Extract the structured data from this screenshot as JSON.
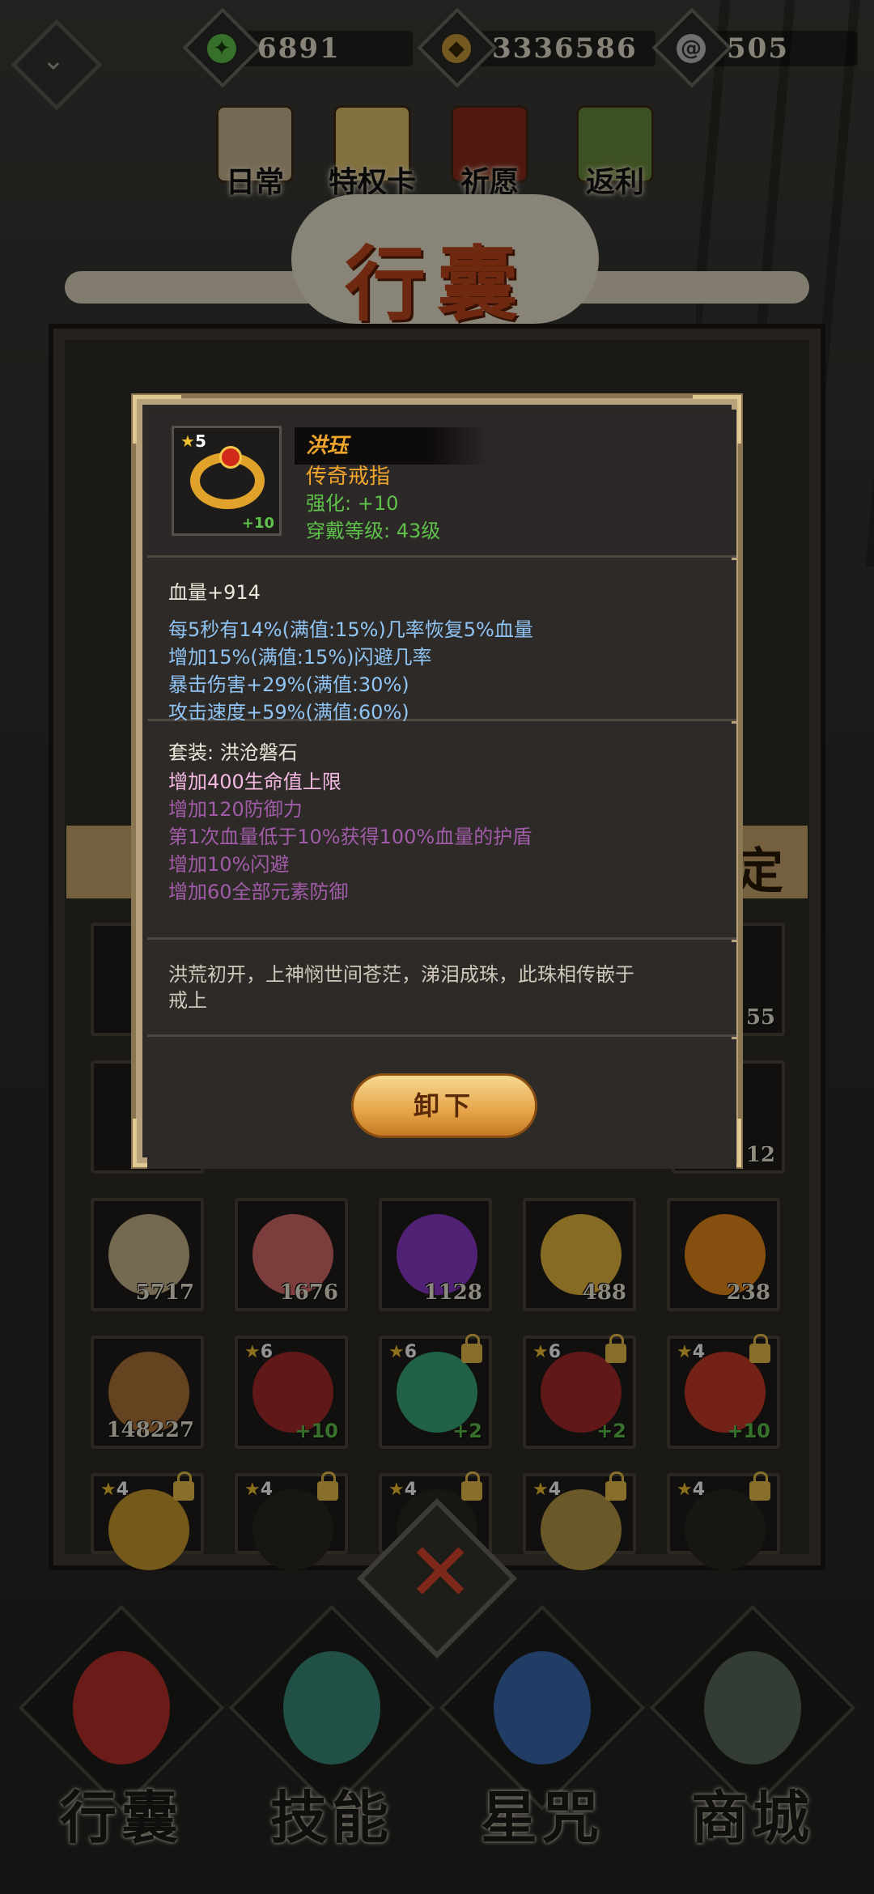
{
  "currencies": [
    {
      "icon": "green-jade-icon",
      "value": "6891",
      "color": "#5ec24a"
    },
    {
      "icon": "copper-coin-icon",
      "value": "3336586",
      "color": "#c99a3a"
    },
    {
      "icon": "silver-spiral-icon",
      "value": "505",
      "color": "#bfbfbf"
    }
  ],
  "events": [
    {
      "label": "日常",
      "icon": "scroll-icon"
    },
    {
      "label": "特权卡",
      "icon": "card-icon"
    },
    {
      "label": "祈愿",
      "icon": "shrine-icon"
    },
    {
      "label": "返利",
      "icon": "treasure-chest-icon"
    }
  ],
  "panel_title": "行囊",
  "tab_label": "定",
  "grid": {
    "row_partial": [
      {
        "count": "55"
      },
      {
        "count": "12"
      }
    ],
    "row3": [
      {
        "icon": "rice-sack-icon",
        "count": "5717",
        "color": "#c9b48a"
      },
      {
        "icon": "peach-icon",
        "count": "1676",
        "color": "#d66a6a"
      },
      {
        "icon": "purple-orb-icon",
        "count": "1128",
        "color": "#8a3ac8"
      },
      {
        "icon": "talisman-scroll-icon",
        "count": "488",
        "color": "#e8b840"
      },
      {
        "icon": "fire-crystal-icon",
        "count": "238",
        "color": "#e68a1a"
      }
    ],
    "row4": [
      {
        "icon": "wood-bucket-icon",
        "count": "148227",
        "stars": null,
        "plus": null,
        "locked": false,
        "color": "#b07438"
      },
      {
        "icon": "red-robe-icon",
        "count": null,
        "stars": "6",
        "plus": "+10",
        "locked": false,
        "color": "#a82a2a"
      },
      {
        "icon": "jade-pendant-icon",
        "count": null,
        "stars": "6",
        "plus": "+2",
        "locked": true,
        "color": "#3aa87a"
      },
      {
        "icon": "red-robe-icon",
        "count": null,
        "stars": "6",
        "plus": "+2",
        "locked": true,
        "color": "#a82a2a"
      },
      {
        "icon": "blade-icon",
        "count": null,
        "stars": "4",
        "plus": "+10",
        "locked": true,
        "color": "#c83a2a"
      }
    ],
    "row5": [
      {
        "icon": "dragon-ring-icon",
        "stars": "4",
        "locked": true,
        "color": "#c89a30"
      },
      {
        "icon": "dark-helmet-icon",
        "stars": "4",
        "locked": true,
        "color": "#2a2622"
      },
      {
        "icon": "dark-helmet-icon",
        "stars": "4",
        "locked": true,
        "color": "#2a2622"
      },
      {
        "icon": "jade-bracelet-icon",
        "stars": "4",
        "locked": true,
        "color": "#b89848"
      },
      {
        "icon": "dark-helmet-icon",
        "stars": "4",
        "locked": true,
        "color": "#2a2622"
      }
    ]
  },
  "nav": [
    {
      "label": "行囊",
      "icon": "bag-icon",
      "color": "#b8302a"
    },
    {
      "label": "技能",
      "icon": "blade-swirl-icon",
      "color": "#3a8a7a"
    },
    {
      "label": "星咒",
      "icon": "star-map-icon",
      "color": "#3a6ab0"
    },
    {
      "label": "商城",
      "icon": "shop-icon",
      "color": "#5a6a5a"
    }
  ],
  "item": {
    "stars": "5",
    "plus": "+10",
    "name": "洪珏",
    "rarity": "传奇戒指",
    "enhance": "强化: +10",
    "level": "穿戴等级: 43级",
    "base_stat": "血量+914",
    "affixes": [
      "每5秒有14%(满值:15%)几率恢复5%血量",
      "增加15%(满值:15%)闪避几率",
      "暴击伤害+29%(满值:30%)",
      "攻击速度+59%(满值:60%)"
    ],
    "set_name": "套装: 洪沧磐石",
    "set_bonuses_active": [
      "增加400生命值上限"
    ],
    "set_bonuses_inactive": [
      "增加120防御力",
      "第1次血量低于10%获得100%血量的护盾",
      "增加10%闪避",
      "增加60全部元素防御"
    ],
    "lore_line1": "洪荒初开，上神悯世间苍茫，涕泪成珠，此珠相传嵌于",
    "lore_line2": "戒上",
    "unequip_label": "卸下"
  },
  "close_icon": "close-x-icon"
}
